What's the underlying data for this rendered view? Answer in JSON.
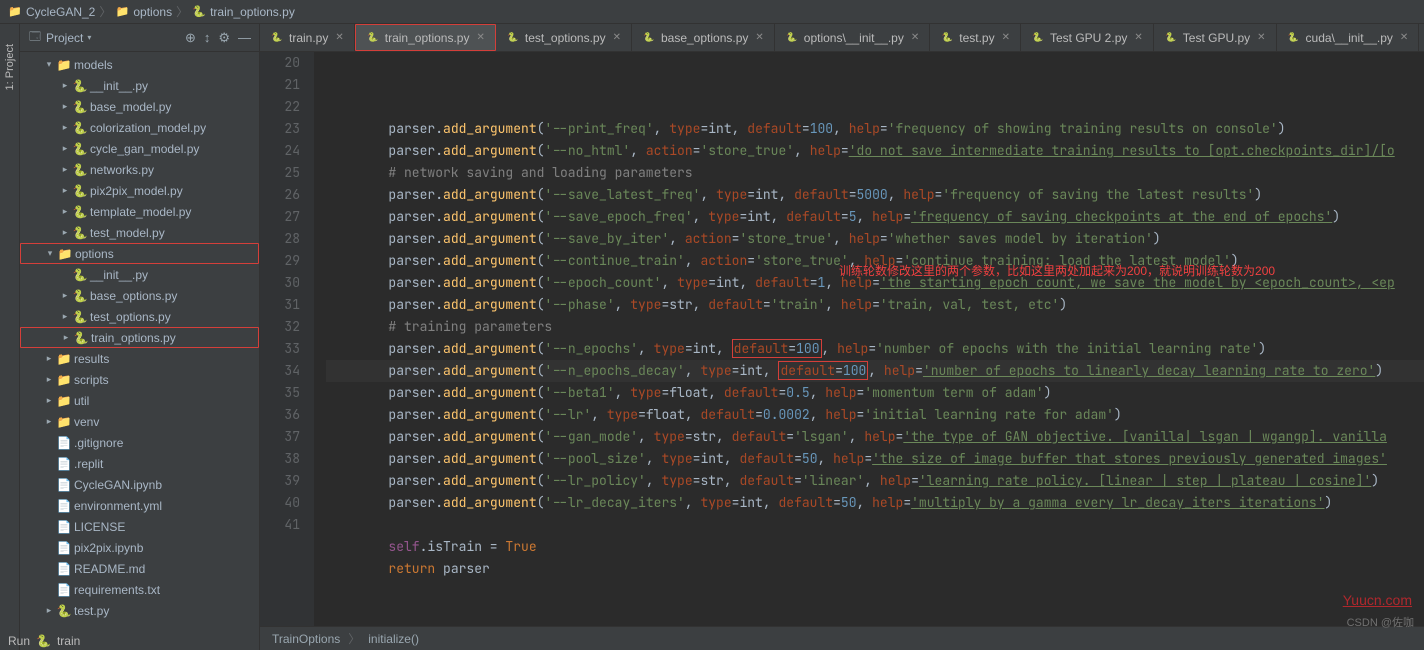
{
  "breadcrumb": [
    "CycleGAN_2",
    "options",
    "train_options.py"
  ],
  "project_label": "Project",
  "sidebar_tab": "1: Project",
  "tabs": [
    {
      "label": "train.py",
      "active": false
    },
    {
      "label": "train_options.py",
      "active": true,
      "highlight": true
    },
    {
      "label": "test_options.py",
      "active": false
    },
    {
      "label": "base_options.py",
      "active": false
    },
    {
      "label": "options\\__init__.py",
      "active": false
    },
    {
      "label": "test.py",
      "active": false
    },
    {
      "label": "Test GPU 2.py",
      "active": false
    },
    {
      "label": "Test GPU.py",
      "active": false
    },
    {
      "label": "cuda\\__init__.py",
      "active": false
    }
  ],
  "tree": [
    {
      "type": "folder",
      "name": "models",
      "level": 1,
      "arrow": "▾"
    },
    {
      "type": "py",
      "name": "__init__.py",
      "level": 2,
      "arrow": "▸"
    },
    {
      "type": "py",
      "name": "base_model.py",
      "level": 2,
      "arrow": "▸"
    },
    {
      "type": "py",
      "name": "colorization_model.py",
      "level": 2,
      "arrow": "▸"
    },
    {
      "type": "py",
      "name": "cycle_gan_model.py",
      "level": 2,
      "arrow": "▸"
    },
    {
      "type": "py",
      "name": "networks.py",
      "level": 2,
      "arrow": "▸"
    },
    {
      "type": "py",
      "name": "pix2pix_model.py",
      "level": 2,
      "arrow": "▸"
    },
    {
      "type": "py",
      "name": "template_model.py",
      "level": 2,
      "arrow": "▸"
    },
    {
      "type": "py",
      "name": "test_model.py",
      "level": 2,
      "arrow": "▸"
    },
    {
      "type": "folder",
      "name": "options",
      "level": 1,
      "arrow": "▾",
      "highlight": true
    },
    {
      "type": "py",
      "name": "__init__.py",
      "level": 2,
      "arrow": ""
    },
    {
      "type": "py",
      "name": "base_options.py",
      "level": 2,
      "arrow": "▸"
    },
    {
      "type": "py",
      "name": "test_options.py",
      "level": 2,
      "arrow": "▸"
    },
    {
      "type": "py",
      "name": "train_options.py",
      "level": 2,
      "arrow": "▸",
      "highlight": true
    },
    {
      "type": "folder",
      "name": "results",
      "level": 1,
      "arrow": "▸"
    },
    {
      "type": "folder",
      "name": "scripts",
      "level": 1,
      "arrow": "▸"
    },
    {
      "type": "folder",
      "name": "util",
      "level": 1,
      "arrow": "▸"
    },
    {
      "type": "folder",
      "name": "venv",
      "level": 1,
      "arrow": "▸",
      "venv": true
    },
    {
      "type": "file",
      "name": ".gitignore",
      "level": 1,
      "arrow": ""
    },
    {
      "type": "file",
      "name": ".replit",
      "level": 1,
      "arrow": ""
    },
    {
      "type": "file",
      "name": "CycleGAN.ipynb",
      "level": 1,
      "arrow": ""
    },
    {
      "type": "file",
      "name": "environment.yml",
      "level": 1,
      "arrow": ""
    },
    {
      "type": "file",
      "name": "LICENSE",
      "level": 1,
      "arrow": ""
    },
    {
      "type": "file",
      "name": "pix2pix.ipynb",
      "level": 1,
      "arrow": ""
    },
    {
      "type": "file",
      "name": "README.md",
      "level": 1,
      "arrow": ""
    },
    {
      "type": "file",
      "name": "requirements.txt",
      "level": 1,
      "arrow": ""
    },
    {
      "type": "py",
      "name": "test.py",
      "level": 1,
      "arrow": "▸"
    }
  ],
  "status": {
    "breadcrumb": [
      "TrainOptions",
      "initialize()"
    ]
  },
  "annotation": "训练轮数修改这里的两个参数，比如这里两处加起来为200，就说明训练轮数为200",
  "watermark_yuu": "Yuucn.com",
  "watermark_csdn": "CSDN @佐咖",
  "bottom": {
    "run_label": "Run",
    "config": "train"
  },
  "code": {
    "lines": [
      20,
      21,
      22,
      23,
      24,
      25,
      26,
      27,
      28,
      29,
      30,
      31,
      32,
      33,
      34,
      35,
      36,
      37,
      38,
      39,
      40,
      41
    ],
    "l20_a": "parser.",
    "l20_b": "add_argument",
    "l20_c": "(",
    "l20_d": "'--print_freq'",
    "l20_e": ", ",
    "l20_type": "type",
    "l20_f": "=int, ",
    "l20_def": "default",
    "l20_g": "=",
    "l20_n": "100",
    "l20_h": ", ",
    "l20_help": "help",
    "l20_i": "=",
    "l20_s": "'frequency of showing training results on console'",
    "l20_j": ")",
    "l21_a": "parser.",
    "l21_b": "add_argument",
    "l21_c": "(",
    "l21_d": "'--no_html'",
    "l21_e": ", ",
    "l21_act": "action",
    "l21_f": "=",
    "l21_av": "'store_true'",
    "l21_g": ", ",
    "l21_help": "help",
    "l21_h": "=",
    "l21_s": "'do not save intermediate training results to [opt.checkpoints_dir]/[o",
    "l21_j": "",
    "l22": "# network saving and loading parameters",
    "l23_a": "parser.",
    "l23_b": "add_argument",
    "l23_c": "(",
    "l23_d": "'--save_latest_freq'",
    "l23_e": ", ",
    "l23_type": "type",
    "l23_f": "=int, ",
    "l23_def": "default",
    "l23_g": "=",
    "l23_n": "5000",
    "l23_h": ", ",
    "l23_help": "help",
    "l23_i": "=",
    "l23_s": "'frequency of saving the latest results'",
    "l23_j": ")",
    "l24_a": "parser.",
    "l24_b": "add_argument",
    "l24_c": "(",
    "l24_d": "'--save_epoch_freq'",
    "l24_e": ", ",
    "l24_type": "type",
    "l24_f": "=int, ",
    "l24_def": "default",
    "l24_g": "=",
    "l24_n": "5",
    "l24_h": ", ",
    "l24_help": "help",
    "l24_i": "=",
    "l24_s": "'frequency of saving checkpoints at the end of epochs'",
    "l24_j": ")",
    "l25_a": "parser.",
    "l25_b": "add_argument",
    "l25_c": "(",
    "l25_d": "'--save_by_iter'",
    "l25_e": ", ",
    "l25_act": "action",
    "l25_f": "=",
    "l25_av": "'store_true'",
    "l25_g": ", ",
    "l25_help": "help",
    "l25_h": "=",
    "l25_s": "'whether saves model by iteration'",
    "l25_j": ")",
    "l26_a": "parser.",
    "l26_b": "add_argument",
    "l26_c": "(",
    "l26_d": "'--continue_train'",
    "l26_e": ", ",
    "l26_act": "action",
    "l26_f": "=",
    "l26_av": "'store_true'",
    "l26_g": ", ",
    "l26_help": "help",
    "l26_h": "=",
    "l26_s": "'continue training: load the latest model'",
    "l26_j": ")",
    "l27_a": "parser.",
    "l27_b": "add_argument",
    "l27_c": "(",
    "l27_d": "'--epoch_count'",
    "l27_e": ", ",
    "l27_type": "type",
    "l27_f": "=int, ",
    "l27_def": "default",
    "l27_g": "=",
    "l27_n": "1",
    "l27_h": ", ",
    "l27_help": "help",
    "l27_i": "=",
    "l27_s": "'the starting epoch count, we save the model by <epoch_count>, <ep",
    "l27_j": "",
    "l28_a": "parser.",
    "l28_b": "add_argument",
    "l28_c": "(",
    "l28_d": "'--phase'",
    "l28_e": ", ",
    "l28_type": "type",
    "l28_f": "=str, ",
    "l28_def": "default",
    "l28_g": "=",
    "l28_dv": "'train'",
    "l28_h": ", ",
    "l28_help": "help",
    "l28_i": "=",
    "l28_s": "'train, val, test, etc'",
    "l28_j": ")",
    "l29": "# training parameters",
    "l30_a": "parser.",
    "l30_b": "add_argument",
    "l30_c": "(",
    "l30_d": "'--n_epochs'",
    "l30_e": ", ",
    "l30_type": "type",
    "l30_f": "=int, ",
    "l30_def": "default",
    "l30_g": "=",
    "l30_n": "100",
    "l30_h": ", ",
    "l30_help": "help",
    "l30_i": "=",
    "l30_s": "'number of epochs with the initial learning rate'",
    "l30_j": ")",
    "l31_a": "parser.",
    "l31_b": "add_argument",
    "l31_c": "(",
    "l31_d": "'--n_epochs_decay'",
    "l31_e": ", ",
    "l31_type": "type",
    "l31_f": "=int, ",
    "l31_def": "default",
    "l31_g": "=",
    "l31_n": "100",
    "l31_h": ", ",
    "l31_help": "help",
    "l31_i": "=",
    "l31_s": "'number of epochs to linearly decay learning rate to zero'",
    "l31_j": ")",
    "l32_a": "parser.",
    "l32_b": "add_argument",
    "l32_c": "(",
    "l32_d": "'--beta1'",
    "l32_e": ", ",
    "l32_type": "type",
    "l32_f": "=float, ",
    "l32_def": "default",
    "l32_g": "=",
    "l32_n": "0.5",
    "l32_h": ", ",
    "l32_help": "help",
    "l32_i": "=",
    "l32_s": "'momentum term of adam'",
    "l32_j": ")",
    "l33_a": "parser.",
    "l33_b": "add_argument",
    "l33_c": "(",
    "l33_d": "'--lr'",
    "l33_e": ", ",
    "l33_type": "type",
    "l33_f": "=float, ",
    "l33_def": "default",
    "l33_g": "=",
    "l33_n": "0.0002",
    "l33_h": ", ",
    "l33_help": "help",
    "l33_i": "=",
    "l33_s": "'initial learning rate for adam'",
    "l33_j": ")",
    "l34_a": "parser.",
    "l34_b": "add_argument",
    "l34_c": "(",
    "l34_d": "'--gan_mode'",
    "l34_e": ", ",
    "l34_type": "type",
    "l34_f": "=str, ",
    "l34_def": "default",
    "l34_g": "=",
    "l34_dv": "'lsgan'",
    "l34_h": ", ",
    "l34_help": "help",
    "l34_i": "=",
    "l34_s": "'the type of GAN objective. [vanilla| lsgan | wgangp]. vanilla",
    "l34_j": "",
    "l35_a": "parser.",
    "l35_b": "add_argument",
    "l35_c": "(",
    "l35_d": "'--pool_size'",
    "l35_e": ", ",
    "l35_type": "type",
    "l35_f": "=int, ",
    "l35_def": "default",
    "l35_g": "=",
    "l35_n": "50",
    "l35_h": ", ",
    "l35_help": "help",
    "l35_i": "=",
    "l35_s": "'the size of image buffer that stores previously generated images'",
    "l35_j": "",
    "l36_a": "parser.",
    "l36_b": "add_argument",
    "l36_c": "(",
    "l36_d": "'--lr_policy'",
    "l36_e": ", ",
    "l36_type": "type",
    "l36_f": "=str, ",
    "l36_def": "default",
    "l36_g": "=",
    "l36_dv": "'linear'",
    "l36_h": ", ",
    "l36_help": "help",
    "l36_i": "=",
    "l36_s": "'learning rate policy. [linear | step | plateau | cosine]'",
    "l36_j": ")",
    "l37_a": "parser.",
    "l37_b": "add_argument",
    "l37_c": "(",
    "l37_d": "'--lr_decay_iters'",
    "l37_e": ", ",
    "l37_type": "type",
    "l37_f": "=int, ",
    "l37_def": "default",
    "l37_g": "=",
    "l37_n": "50",
    "l37_h": ", ",
    "l37_help": "help",
    "l37_i": "=",
    "l37_s": "'multiply by a gamma every lr_decay_iters iterations'",
    "l37_j": ")",
    "l39_self": "self",
    "l39_a": ".isTrain = ",
    "l39_true": "True",
    "l40_ret": "return",
    "l40_a": " parser"
  }
}
